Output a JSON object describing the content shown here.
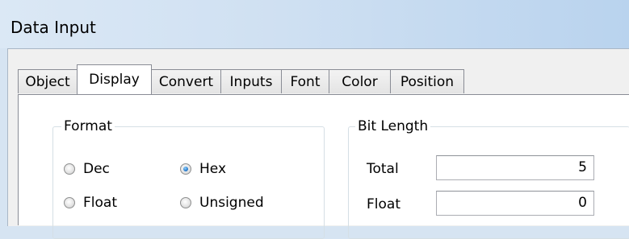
{
  "window": {
    "title": "Data Input"
  },
  "tabs": [
    {
      "label": "Object"
    },
    {
      "label": "Display",
      "active": true
    },
    {
      "label": "Convert"
    },
    {
      "label": "Inputs"
    },
    {
      "label": "Font"
    },
    {
      "label": "Color"
    },
    {
      "label": "Position"
    }
  ],
  "format": {
    "legend": "Format",
    "options": [
      {
        "label": "Dec",
        "selected": false
      },
      {
        "label": "Hex",
        "selected": true
      },
      {
        "label": "Float",
        "selected": false
      },
      {
        "label": "Unsigned",
        "selected": false
      }
    ]
  },
  "bit_length": {
    "legend": "Bit Length",
    "total_label": "Total",
    "total_value": "5",
    "float_label": "Float",
    "float_value": "0"
  },
  "colors": {
    "radio_selected": "#1c6fc2",
    "tab_border": "#898c95"
  }
}
